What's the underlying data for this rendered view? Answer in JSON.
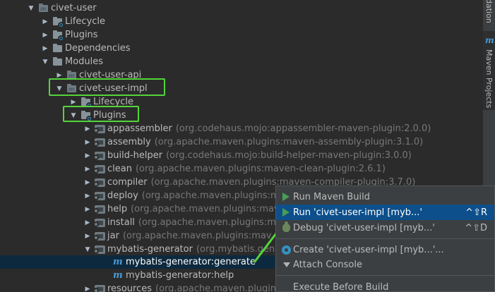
{
  "tree": [
    {
      "label": "civet-user",
      "arrow": "▼",
      "icon": "module",
      "indent": 38
    },
    {
      "label": "Lifecycle",
      "arrow": "▶",
      "icon": "folder-gear",
      "indent": 58
    },
    {
      "label": "Plugins",
      "arrow": "▶",
      "icon": "folder-gear",
      "indent": 58
    },
    {
      "label": "Dependencies",
      "arrow": "▶",
      "icon": "folder",
      "indent": 58
    },
    {
      "label": "Modules",
      "arrow": "▼",
      "icon": "folder",
      "indent": 58
    },
    {
      "label": "civet-user-api",
      "arrow": "▶",
      "icon": "module",
      "indent": 78
    },
    {
      "label": "civet-user-impl",
      "arrow": "▼",
      "icon": "module",
      "indent": 78
    },
    {
      "label": "Lifecycle",
      "arrow": "▶",
      "icon": "folder-gear",
      "indent": 98
    },
    {
      "label": "Plugins",
      "arrow": "▼",
      "icon": "folder-gear",
      "indent": 98
    },
    {
      "label": "appassembler",
      "sub": "(org.codehaus.mojo:appassembler-maven-plugin:2.0.0)",
      "arrow": "▶",
      "icon": "plugin",
      "indent": 118
    },
    {
      "label": "assembly",
      "sub": "(org.apache.maven.plugins:maven-assembly-plugin:3.1.0)",
      "arrow": "▶",
      "icon": "plugin",
      "indent": 118
    },
    {
      "label": "build-helper",
      "sub": "(org.codehaus.mojo:build-helper-maven-plugin:3.0.0)",
      "arrow": "▶",
      "icon": "plugin",
      "indent": 118
    },
    {
      "label": "clean",
      "sub": "(org.apache.maven.plugins:maven-clean-plugin:2.6.1)",
      "arrow": "▶",
      "icon": "plugin",
      "indent": 118
    },
    {
      "label": "compiler",
      "sub": "(org.apache.maven.plugins:maven-compiler-plugin:3.7.0)",
      "arrow": "▶",
      "icon": "plugin",
      "indent": 118
    },
    {
      "label": "deploy",
      "sub": "(org.apache.maven.plugins:ma",
      "arrow": "▶",
      "icon": "plugin",
      "indent": 118
    },
    {
      "label": "help",
      "sub": "(org.apache.maven.plugins:mav",
      "arrow": "▶",
      "icon": "plugin",
      "indent": 118
    },
    {
      "label": "install",
      "sub": "(org.apache.maven.plugins:mav",
      "arrow": "▶",
      "icon": "plugin",
      "indent": 118
    },
    {
      "label": "jar",
      "sub": "(org.apache.maven.plugins:mav",
      "arrow": "▶",
      "icon": "plugin",
      "indent": 118
    },
    {
      "label": "mybatis-generator",
      "sub": "(org.mybatis.genera",
      "arrow": "▼",
      "icon": "plugin",
      "indent": 118
    },
    {
      "label": "mybatis-generator:generate",
      "arrow": "",
      "icon": "goal",
      "indent": 144,
      "selected": true
    },
    {
      "label": "mybatis-generator:help",
      "arrow": "",
      "icon": "goal",
      "indent": 144
    },
    {
      "label": "resources",
      "sub": "(org.apache.maven.plugins",
      "arrow": "▶",
      "icon": "plugin",
      "indent": 118
    }
  ],
  "sidebar": {
    "top_tab": "dation",
    "tab_label": "Maven Projects",
    "tab_icon": "m"
  },
  "context_menu": {
    "items": [
      {
        "label": "Run Maven Build",
        "shortcut": "",
        "icon": "run-icon"
      },
      {
        "label": "Run 'civet-user-impl [myb...'",
        "shortcut": "^⇧R",
        "icon": "run-icon",
        "active": true
      },
      {
        "label": "Debug 'civet-user-impl [myb...'",
        "shortcut": "^⇧D",
        "icon": "debug-icon"
      },
      {
        "label": "Create 'civet-user-impl [myb...'...",
        "shortcut": "",
        "icon": "settings-icon"
      },
      {
        "label": "Attach Console",
        "shortcut": "",
        "icon": "attach-icon"
      },
      {
        "label": "Execute Before Build",
        "shortcut": "",
        "icon": ""
      }
    ]
  },
  "colors": {
    "background": "#2b2b2b",
    "highlight": "#53d53a",
    "selection": "#0d293e",
    "menu_active": "#0d4f8b"
  }
}
